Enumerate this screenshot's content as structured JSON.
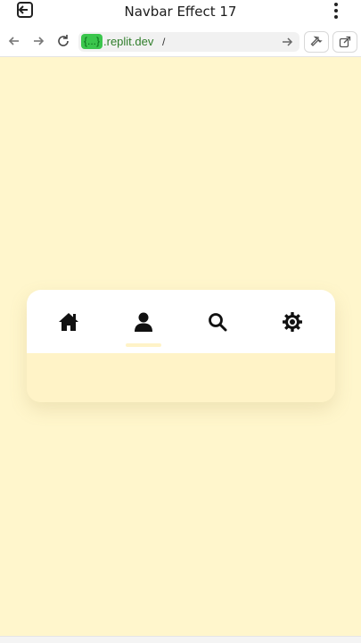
{
  "app": {
    "title": "Navbar Effect 17"
  },
  "browser": {
    "url_chip": "{...}",
    "url_host": ".replit.dev",
    "url_path": "/"
  },
  "navbar": {
    "items": [
      {
        "name": "home",
        "icon": "home-icon"
      },
      {
        "name": "profile",
        "icon": "user-icon",
        "active": true
      },
      {
        "name": "search",
        "icon": "search-icon"
      },
      {
        "name": "settings",
        "icon": "gear-icon"
      }
    ]
  },
  "colors": {
    "background": "#FFF6CC",
    "card": "#FFFFFF",
    "card_bottom": "#FFF3C7",
    "url_chip": "#3BC64D"
  }
}
